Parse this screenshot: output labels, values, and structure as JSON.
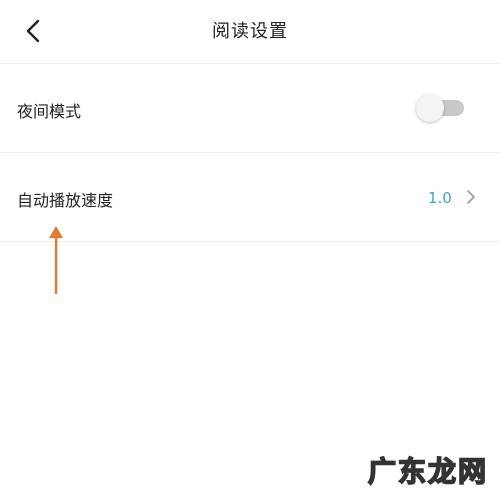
{
  "header": {
    "title": "阅读设置",
    "back_icon": "chevron-left-icon"
  },
  "settings": [
    {
      "label": "夜间模式",
      "control": "toggle",
      "on": false
    },
    {
      "label": "自动播放速度",
      "value": "1.0",
      "control": "chevron-right-icon"
    }
  ],
  "colors": {
    "value_text": "#3ea2d0",
    "annotation_arrow": "#e8782a",
    "toggle_track": "#c9c9c9"
  },
  "annotation": {
    "icon": "up-arrow-icon"
  },
  "watermark": {
    "text": "广东龙网"
  }
}
